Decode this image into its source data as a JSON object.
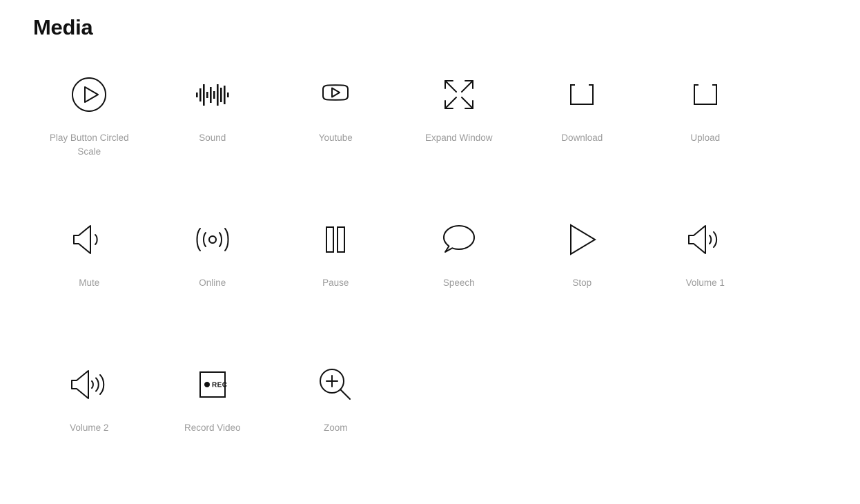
{
  "page": {
    "title": "Media",
    "background_color": "#ffffff",
    "icon_color": "#111111",
    "label_color": "#9b9b9b"
  },
  "grid": {
    "columns": 6,
    "rows": 3,
    "items": [
      {
        "label": "Play Button Circled Scale",
        "icon": "play-button-circled-scale-icon"
      },
      {
        "label": "Sound",
        "icon": "sound-waveform-icon"
      },
      {
        "label": "Youtube",
        "icon": "youtube-icon"
      },
      {
        "label": "Expand Window",
        "icon": "expand-window-icon"
      },
      {
        "label": "Download",
        "icon": "download-icon"
      },
      {
        "label": "Upload",
        "icon": "upload-icon"
      },
      {
        "label": "Mute",
        "icon": "mute-speaker-icon"
      },
      {
        "label": "Online",
        "icon": "online-broadcast-icon"
      },
      {
        "label": "Pause",
        "icon": "pause-icon"
      },
      {
        "label": "Speech",
        "icon": "speech-bubble-icon"
      },
      {
        "label": "Stop",
        "icon": "stop-play-triangle-icon"
      },
      {
        "label": "Volume 1",
        "icon": "volume-1-speaker-icon"
      },
      {
        "label": "Volume 2",
        "icon": "volume-2-speaker-icon"
      },
      {
        "label": "Record Video",
        "icon": "record-video-icon"
      },
      {
        "label": "Zoom",
        "icon": "zoom-magnifier-icon"
      }
    ]
  },
  "record_video": {
    "badge_text": "REC"
  }
}
